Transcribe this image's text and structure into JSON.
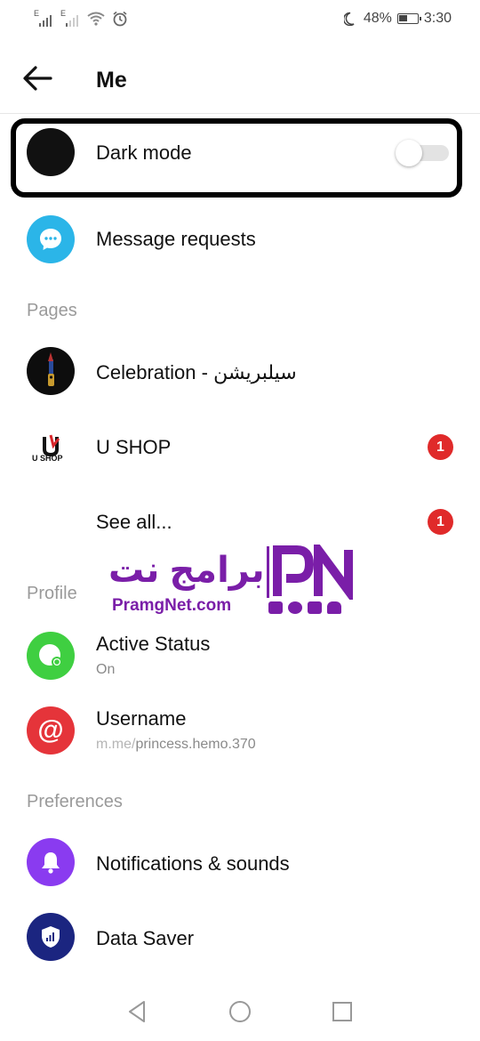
{
  "status_bar": {
    "signal_1": "E",
    "signal_2": "E",
    "battery": "48%",
    "time": "3:30"
  },
  "header": {
    "title": "Me"
  },
  "dark_mode": {
    "label": "Dark mode",
    "enabled": false
  },
  "message_requests": {
    "label": "Message requests"
  },
  "pages": {
    "section_label": "Pages",
    "items": [
      {
        "label": "Celebration - سيلبريشن"
      },
      {
        "label": "U SHOP",
        "badge": "1",
        "logo_text": "U SHOP"
      }
    ],
    "see_all": {
      "label": "See all...",
      "badge": "1"
    }
  },
  "profile": {
    "section_label": "Profile",
    "active_status": {
      "label": "Active Status",
      "value": "On"
    },
    "username": {
      "label": "Username",
      "prefix": "m.me/",
      "handle": "princess.hemo.370"
    }
  },
  "preferences": {
    "section_label": "Preferences",
    "notifications": {
      "label": "Notifications & sounds"
    },
    "data_saver": {
      "label": "Data Saver"
    }
  },
  "watermark": {
    "arabic": "برامج نت",
    "english": "PramgNet.com",
    "logo": "PN"
  },
  "colors": {
    "message_requests": "#2bb5e8",
    "active_status": "#3fcf41",
    "username": "#e5343a",
    "notifications": "#8a3bf0",
    "data_saver": "#1b2580",
    "watermark": "#7a1ea8",
    "badge": "#e02a2a"
  }
}
